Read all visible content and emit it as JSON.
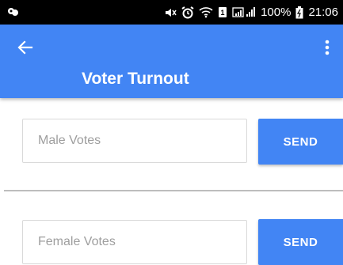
{
  "status_bar": {
    "battery_percent": "100%",
    "time": "21:06",
    "left_icon": "app-notification-icon",
    "icons": [
      "mute-icon",
      "alarm-icon",
      "wifi-icon",
      "sim-icon",
      "signal-icon",
      "battery-icon"
    ]
  },
  "app_bar": {
    "title": "Voter Turnout",
    "back_icon": "arrow-left-icon",
    "menu_icon": "more-vert-icon",
    "color": "#4285f4"
  },
  "male": {
    "placeholder": "Male Votes",
    "send_label": "SEND"
  },
  "female": {
    "placeholder": "Female Votes",
    "send_label": "SEND"
  }
}
